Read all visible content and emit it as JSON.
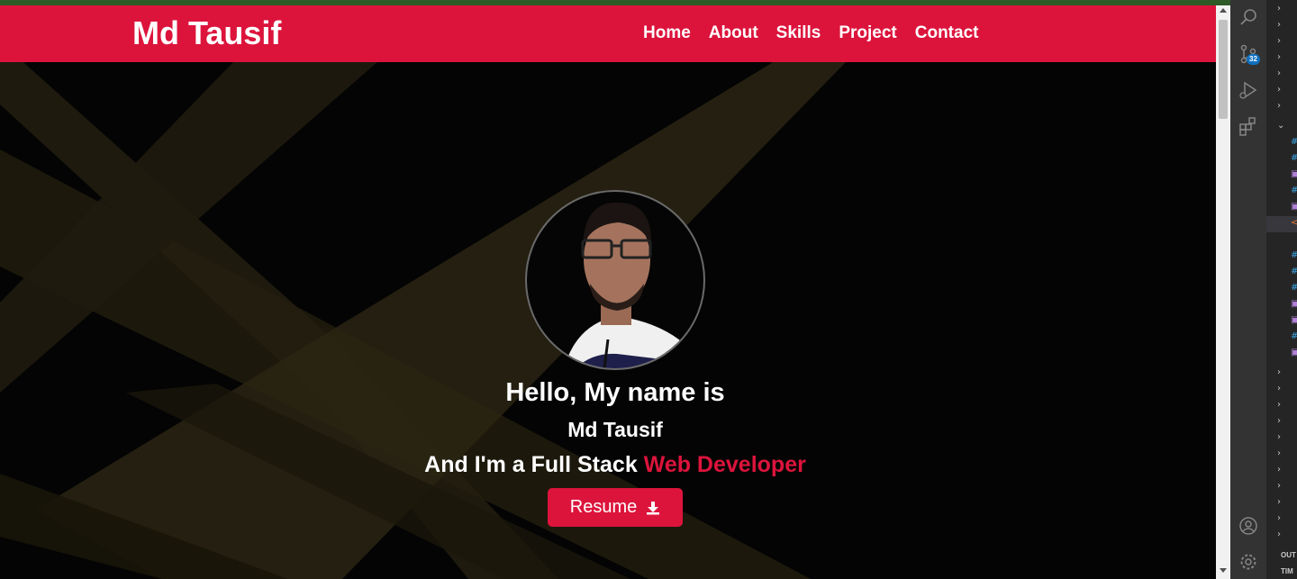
{
  "site": {
    "brand": "Md Tausif",
    "nav": [
      "Home",
      "About",
      "Skills",
      "Project",
      "Contact"
    ],
    "hero": {
      "greeting": "Hello, My name is",
      "name": "Md Tausif",
      "tagline_prefix": "And I'm a Full Stack ",
      "tagline_highlight": "Web Developer",
      "resume_label": "Resume"
    }
  },
  "colors": {
    "accent": "#dc143c",
    "page_bg": "#040404",
    "editor_activity_bar": "#333333",
    "editor_sidebar": "#252526"
  },
  "editor": {
    "activity_icons": [
      "search-icon",
      "source-control-icon",
      "run-debug-icon",
      "extensions-icon",
      "account-icon",
      "settings-gear-icon"
    ],
    "source_control_badge": "32",
    "panels": [
      "OUT",
      "TIM"
    ]
  }
}
